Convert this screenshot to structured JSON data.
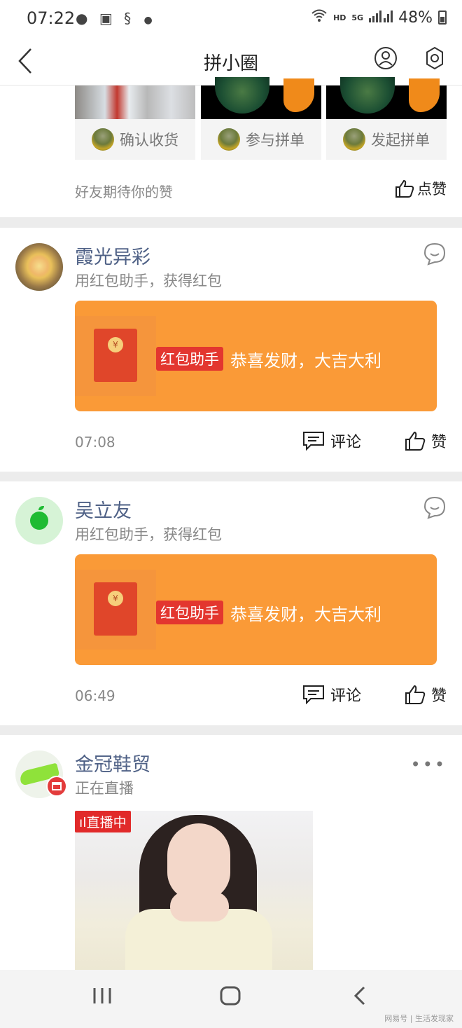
{
  "status_bar": {
    "time": "07:22",
    "hd": "HD",
    "net": "5G",
    "battery": "48%"
  },
  "nav": {
    "title": "拼小圈"
  },
  "top_card": {
    "pills": [
      "确认收货",
      "参与拼单",
      "发起拼单"
    ],
    "friends_text": "好友期待你的赞",
    "like_label": "点赞"
  },
  "posts": [
    {
      "name": "霞光异彩",
      "subtitle": "用红包助手，获得红包",
      "tag": "红包助手",
      "message": "恭喜发财，大吉大利",
      "time": "07:08",
      "comment_label": "评论",
      "like_label": "赞"
    },
    {
      "name": "吴立友",
      "subtitle": "用红包助手，获得红包",
      "tag": "红包助手",
      "message": "恭喜发财，大吉大利",
      "time": "06:49",
      "comment_label": "评论",
      "like_label": "赞"
    },
    {
      "name": "金冠鞋贸",
      "subtitle": "正在直播",
      "live_tag": "直播中"
    }
  ],
  "watermark": "网易号 | 生活发现家",
  "colors": {
    "accent_orange": "#fa9a37",
    "red": "#e3362f",
    "name_blue": "#4f6186"
  }
}
